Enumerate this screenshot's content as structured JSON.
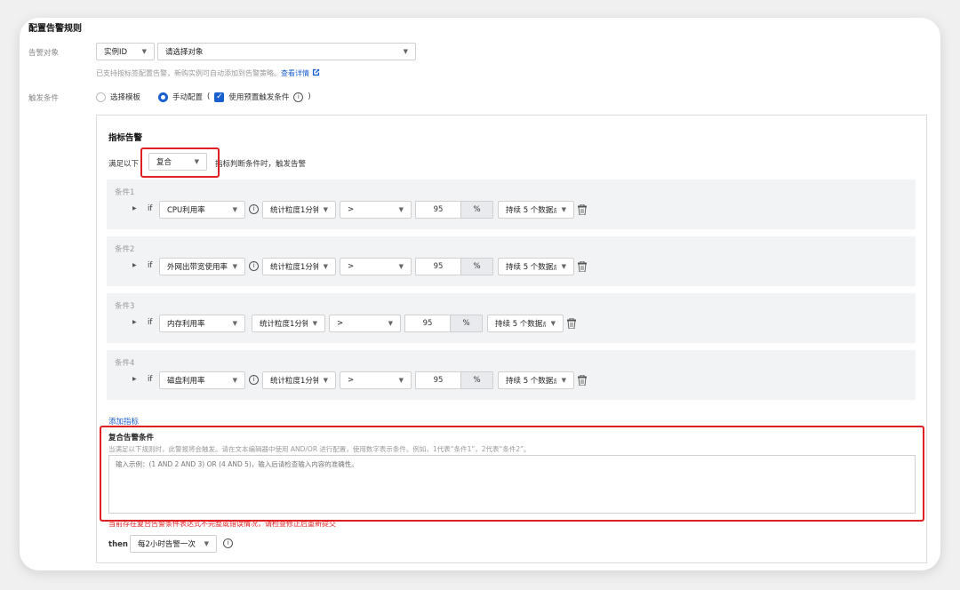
{
  "title": "配置告警规则",
  "target": {
    "label": "告警对象",
    "type_value": "实例ID",
    "object_placeholder": "请选择对象",
    "hint": "已支持按标签配置告警，新购实例可自动添加到告警策略。",
    "hint_link": "查看详情"
  },
  "trigger": {
    "label": "触发条件",
    "option_template": "选择模板",
    "option_manual": "手动配置",
    "paren_open": "(",
    "paren_close": ")",
    "use_preset": "使用预置触发条件"
  },
  "metric_alarm": {
    "heading": "指标告警",
    "satisfy_prefix": "满足以下",
    "satisfy_value": "复合",
    "satisfy_suffix": "指标判断条件时，触发告警",
    "if_label": "if",
    "conditions": [
      {
        "name": "条件1",
        "metric": "CPU利用率",
        "period": "统计粒度1分钟",
        "op": ">",
        "value": "95",
        "unit": "%",
        "duration": "持续 5 个数据点",
        "has_info": true
      },
      {
        "name": "条件2",
        "metric": "外网出带宽使用率",
        "period": "统计粒度1分钟",
        "op": ">",
        "value": "95",
        "unit": "%",
        "duration": "持续 5 个数据点",
        "has_info": true
      },
      {
        "name": "条件3",
        "metric": "内存利用率",
        "period": "统计粒度1分钟",
        "op": ">",
        "value": "95",
        "unit": "%",
        "duration": "持续 5 个数据点",
        "has_info": false
      },
      {
        "name": "条件4",
        "metric": "磁盘利用率",
        "period": "统计粒度1分钟",
        "op": ">",
        "value": "95",
        "unit": "%",
        "duration": "持续 5 个数据点",
        "has_info": true
      }
    ],
    "add_metric": "添加指标"
  },
  "composite": {
    "heading": "复合告警条件",
    "desc": "当满足以下规则时，此警报将会触发。请在文本编辑器中使用 AND/OR 进行配置，使用数字表示条件。例如，1代表“条件1”，2代表“条件2”。",
    "placeholder": "输入示例：(1 AND 2 AND 3) OR (4 AND 5)，输入后请检查输入内容的准确性。",
    "error": "当前存在复合告警条件表达式不完整或错误情况，请检查修正后重新提交"
  },
  "then": {
    "label": "then",
    "value": "每2小时告警一次"
  },
  "colors": {
    "accent": "#1a5fd0",
    "error": "#e02020"
  }
}
